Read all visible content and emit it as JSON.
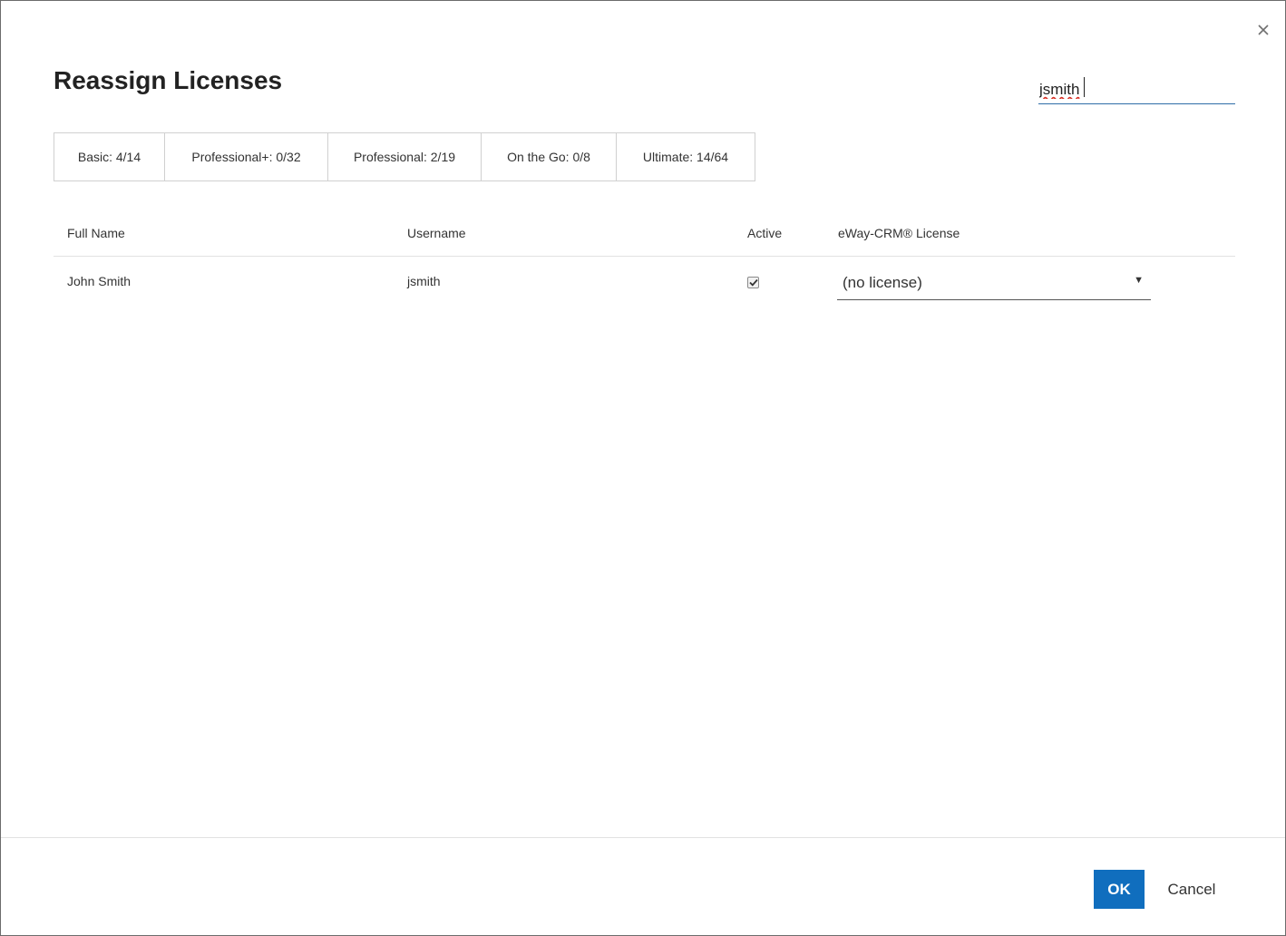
{
  "dialog": {
    "title": "Reassign Licenses",
    "close_icon": "close-icon"
  },
  "search": {
    "value": "jsmith",
    "placeholder": ""
  },
  "license_summary": [
    {
      "label": "Basic: 4/14"
    },
    {
      "label": "Professional+: 0/32"
    },
    {
      "label": "Professional: 2/19"
    },
    {
      "label": "On the Go: 0/8"
    },
    {
      "label": "Ultimate: 14/64"
    }
  ],
  "table": {
    "headers": {
      "full_name": "Full Name",
      "username": "Username",
      "active": "Active",
      "license": "eWay-CRM® License"
    },
    "rows": [
      {
        "full_name": "John Smith",
        "username": "jsmith",
        "active": true,
        "license": "(no license)"
      }
    ]
  },
  "footer": {
    "ok_label": "OK",
    "cancel_label": "Cancel"
  },
  "colors": {
    "accent": "#106ebe",
    "input_underline": "#2f6ea8",
    "border": "#d0d0d0"
  }
}
